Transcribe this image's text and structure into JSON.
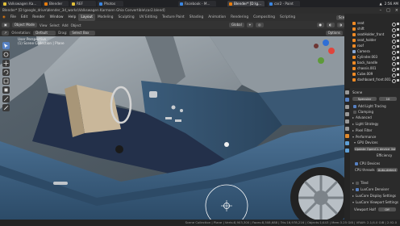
{
  "taskbar": {
    "tabs": [
      {
        "label": "Volkswagen Ka...",
        "color": "#e2c03a"
      },
      {
        "label": "Blender",
        "color": "#e87d0d"
      },
      {
        "label": "REF",
        "color": "#e2c03a"
      },
      {
        "label": "Photos",
        "color": "#3a86e2"
      },
      {
        "label": "Facebook - M...",
        "color": "#3a86e2"
      },
      {
        "label": "Blender* [D:\\g...",
        "color": "#e87d0d"
      },
      {
        "label": "car2 - Paint",
        "color": "#3a86e2"
      }
    ],
    "active_tab_index": 5,
    "clock": "2:56 AM"
  },
  "window": {
    "title": "Blender* [D:\\google_drive\\blender_3d_works\\Volkswagen Karmann Ghia Convertible\\car2.blend]"
  },
  "menu": [
    "File",
    "Edit",
    "Render",
    "Window",
    "Help"
  ],
  "workspaces": [
    "Layout",
    "Modeling",
    "Sculpting",
    "UV Editing",
    "Texture Paint",
    "Shading",
    "Animation",
    "Rendering",
    "Compositing",
    "Scripting"
  ],
  "active_workspace_index": 0,
  "scene_field": "Scene",
  "view_layer_field": "View Layer.001",
  "viewport": {
    "mode": "Object Mode",
    "menus": [
      "View",
      "Select",
      "Add",
      "Object"
    ],
    "orientation_label": "Orientation:",
    "orientation_value": "Default",
    "drag_label": "Drag:",
    "drag_value": "Select Box",
    "transform": "Global",
    "options": "Options",
    "overlay_line1": "User Perspective",
    "overlay_line2": "(1) Scene Collection | Plane"
  },
  "outliner": {
    "rows": [
      "seat",
      "shift",
      "seatHolder_front",
      "seat_holder",
      "roof",
      "Camera",
      "Cylinder.003",
      "back_handle",
      "chassis.001",
      "Cube.009",
      "dashboard_front.001"
    ],
    "selected_index": -1
  },
  "properties": {
    "scene_label": "Scene",
    "render_engine": "Specular",
    "render_count": "10",
    "rows": [
      {
        "kind": "check",
        "label": "Add Light Tracing"
      },
      {
        "kind": "check",
        "label": "Clamping"
      },
      {
        "kind": "section",
        "label": "Advanced"
      },
      {
        "kind": "section",
        "label": "Light Strategy"
      },
      {
        "kind": "section",
        "label": "Pixel Filter"
      },
      {
        "kind": "section",
        "label": "Performance"
      },
      {
        "kind": "section",
        "label": "GPU Devices"
      }
    ],
    "update_button": "Update OpenCL device list",
    "efficiency": "Efficiency",
    "cpu_devices": "CPU Devices",
    "cpu_threads_label": "CPU threads",
    "cpu_threads_value": "Auto-detect",
    "tiled": "Tiled",
    "denoiser": "LuxCore Denoiser",
    "display_settings": "LuxCore Display Settings",
    "viewport_settings": "LuxCore Viewport Settings",
    "viewport_half_label": "Viewport Half",
    "viewport_half_value": "Off"
  },
  "status_text": "Scene Collection | Plane | Verts:8,903,300 | Faces:8,508,688 | Tris:16,978,216 | Objects:1/443 | Mem:3.25 GiB | VRAM: 2.1/4.0 GiB | 2.92.0"
}
